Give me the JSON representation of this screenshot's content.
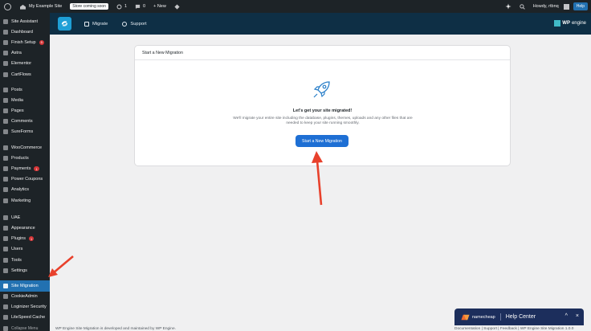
{
  "adminbar": {
    "site_name": "My Example Site",
    "store_badge": "Store coming soon",
    "updates_count": "1",
    "comments_count": "0",
    "new_label": "+ New",
    "howdy": "Howdy, rtbnq",
    "help_label": "Help"
  },
  "sidebar": {
    "items": [
      {
        "label": "Site Assistant",
        "icon": "star-icon"
      },
      {
        "label": "Dashboard",
        "icon": "dashboard-icon"
      },
      {
        "label": "Finish Setup",
        "icon": "flag-icon",
        "badge": "5"
      },
      {
        "label": "Astra",
        "icon": "astra-icon"
      },
      {
        "label": "Elementor",
        "icon": "elementor-icon"
      },
      {
        "label": "CartFlows",
        "icon": "cartflows-icon"
      },
      {
        "label": "Posts",
        "icon": "pin-icon"
      },
      {
        "label": "Media",
        "icon": "media-icon"
      },
      {
        "label": "Pages",
        "icon": "pages-icon"
      },
      {
        "label": "Comments",
        "icon": "comments-icon"
      },
      {
        "label": "SureForms",
        "icon": "sureforms-icon"
      },
      {
        "label": "WooCommerce",
        "icon": "woocommerce-icon"
      },
      {
        "label": "Products",
        "icon": "products-icon"
      },
      {
        "label": "Payments",
        "icon": "payments-icon",
        "badge": "1"
      },
      {
        "label": "Power Coupons",
        "icon": "coupon-icon"
      },
      {
        "label": "Analytics",
        "icon": "analytics-icon"
      },
      {
        "label": "Marketing",
        "icon": "marketing-icon"
      },
      {
        "label": "UAE",
        "icon": "uae-icon"
      },
      {
        "label": "Appearance",
        "icon": "appearance-icon"
      },
      {
        "label": "Plugins",
        "icon": "plugins-icon",
        "badge": "1"
      },
      {
        "label": "Users",
        "icon": "users-icon"
      },
      {
        "label": "Tools",
        "icon": "tools-icon"
      },
      {
        "label": "Settings",
        "icon": "settings-icon"
      },
      {
        "label": "Site Migration",
        "icon": "migration-icon",
        "active": true
      },
      {
        "label": "CookieAdmin",
        "icon": "cookie-icon"
      },
      {
        "label": "Loginizer Security",
        "icon": "shield-icon"
      },
      {
        "label": "LiteSpeed Cache",
        "icon": "litespeed-icon"
      },
      {
        "label": "Collapse Menu",
        "icon": "collapse-icon"
      }
    ]
  },
  "header": {
    "nav": [
      {
        "label": "Migrate",
        "icon": "migrate-icon"
      },
      {
        "label": "Support",
        "icon": "support-icon"
      }
    ],
    "brand_wp": "WP",
    "brand_engine": "engine"
  },
  "card": {
    "heading": "Start a New Migration",
    "title": "Let's get your site migrated!",
    "description": "We'll migrate your entire site including the database, plugins, themes, uploads and any other files that are needed to keep your site running smoothly.",
    "button": "Start a New Migration"
  },
  "footer": {
    "left": "WP Engine Site Migration is developed and maintained by WP Engine.",
    "right": "Documentation  |  Support  |  Feedback  |  WP Engine Site Migration 1.0.0"
  },
  "help_widget": {
    "brand": "namecheap",
    "title": "Help Center",
    "minimize": "^",
    "close": "×"
  },
  "colors": {
    "accent": "#2271b1",
    "button": "#1e6fd4",
    "header": "#0e2f45",
    "annotation_arrow": "#e8412c"
  }
}
